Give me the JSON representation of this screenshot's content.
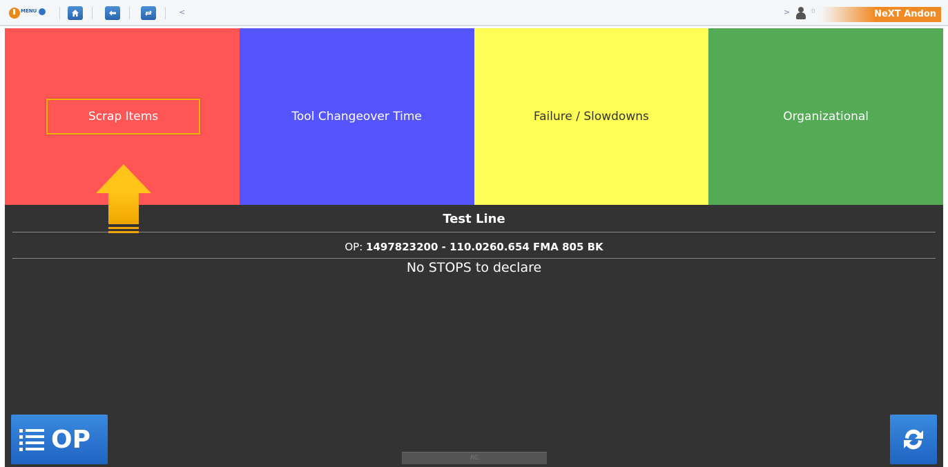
{
  "topbar": {
    "menu_label": "MENU",
    "back_chevron": "<",
    "forward_chevron": ">",
    "user_count": "0",
    "brand": "NeXT Andon"
  },
  "categories": [
    {
      "label": "Scrap Items",
      "color": "#ff5555"
    },
    {
      "label": "Tool Changeover Time",
      "color": "#5555ff"
    },
    {
      "label": "Failure / Slowdowns",
      "color": "#ffff55"
    },
    {
      "label": "Organizational",
      "color": "#55aa55"
    }
  ],
  "line": {
    "title": "Test Line",
    "op_prefix": "OP:",
    "op_value": "1497823200 - 110.0260.654 FMA 805 BK",
    "status": "No STOPS to declare"
  },
  "buttons": {
    "op_label": "OP",
    "footer_label": "RC"
  },
  "icons": {
    "logo": "power-icon",
    "home": "home-icon",
    "back": "arrow-left-icon",
    "swap": "swap-icon",
    "user": "user-icon",
    "list": "list-icon",
    "refresh": "refresh-icon",
    "pointer": "arrow-up-icon"
  },
  "colors": {
    "accent": "#f08a24",
    "button_blue": "#2a72cc",
    "panel_bg": "#333333",
    "highlight": "#f0b400"
  }
}
